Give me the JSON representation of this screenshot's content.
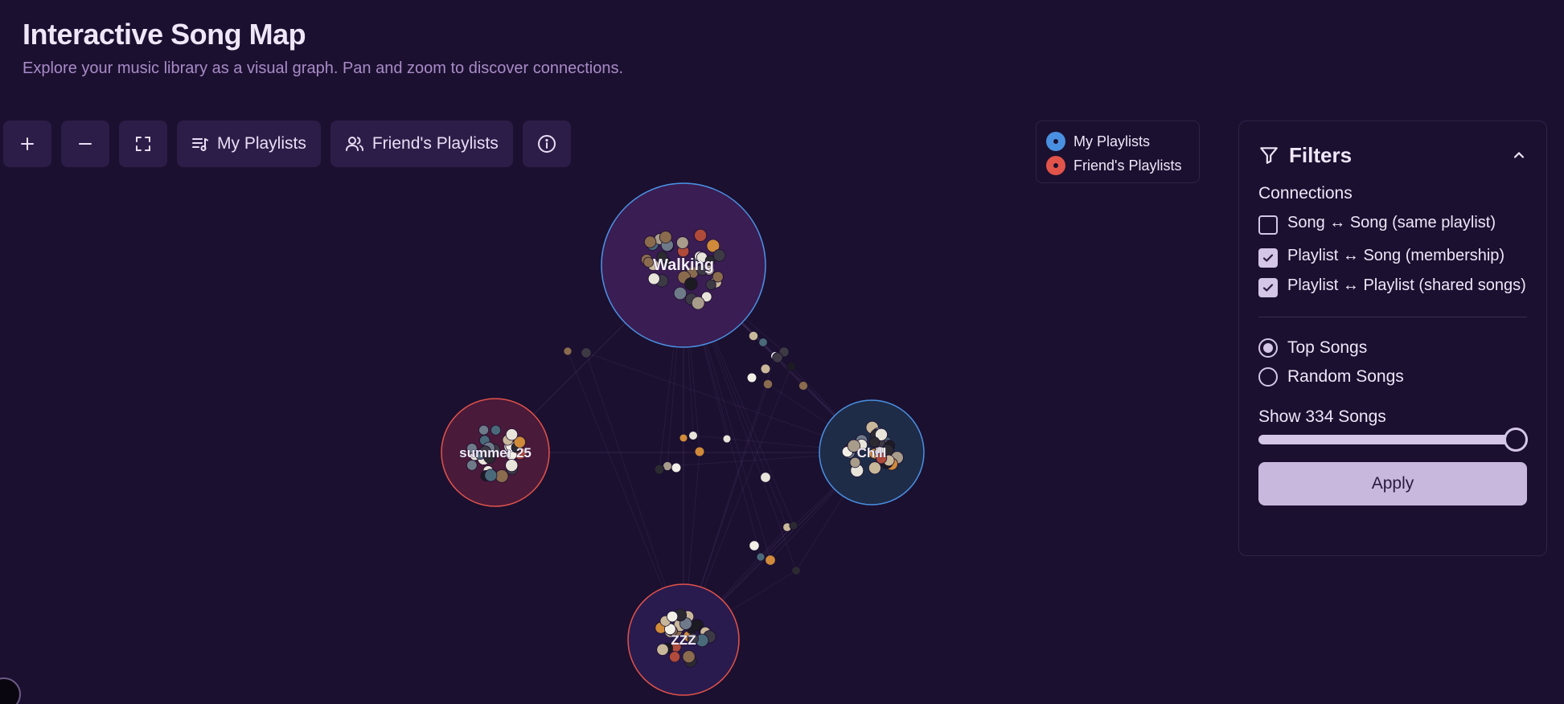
{
  "header": {
    "title": "Interactive Song Map",
    "subtitle": "Explore your music library as a visual graph. Pan and zoom to discover connections."
  },
  "toolbar": {
    "zoom_in_icon": "plus-icon",
    "zoom_out_icon": "minus-icon",
    "fit_icon": "fullscreen-icon",
    "my_playlists_label": "My Playlists",
    "friends_playlists_label": "Friend's Playlists",
    "info_icon": "info-icon"
  },
  "legend": {
    "items": [
      {
        "label": "My Playlists",
        "color": "#4a90e2"
      },
      {
        "label": "Friend's Playlists",
        "color": "#e2534a"
      }
    ]
  },
  "graph": {
    "playlists": [
      {
        "label": "Walking",
        "owner": "mine"
      },
      {
        "label": "summer 25",
        "owner": "friend"
      },
      {
        "label": "Chill",
        "owner": "mine"
      },
      {
        "label": "ZZZ",
        "owner": "friend"
      }
    ]
  },
  "filters": {
    "title": "Filters",
    "connections_label": "Connections",
    "options": [
      {
        "label": "Song ↔ Song (same playlist)",
        "checked": false
      },
      {
        "label": "Playlist ↔ Song (membership)",
        "checked": true
      },
      {
        "label": "Playlist ↔ Playlist (shared songs)",
        "checked": true
      }
    ],
    "modes": [
      {
        "label": "Top Songs",
        "selected": true
      },
      {
        "label": "Random Songs",
        "selected": false
      }
    ],
    "show_label": "Show 334 Songs",
    "slider_fraction": 1.0,
    "apply_label": "Apply"
  },
  "colors": {
    "background": "#1b1030",
    "mine": "#4a90e2",
    "friend": "#e2534a",
    "accent": "#c8b8dd"
  }
}
